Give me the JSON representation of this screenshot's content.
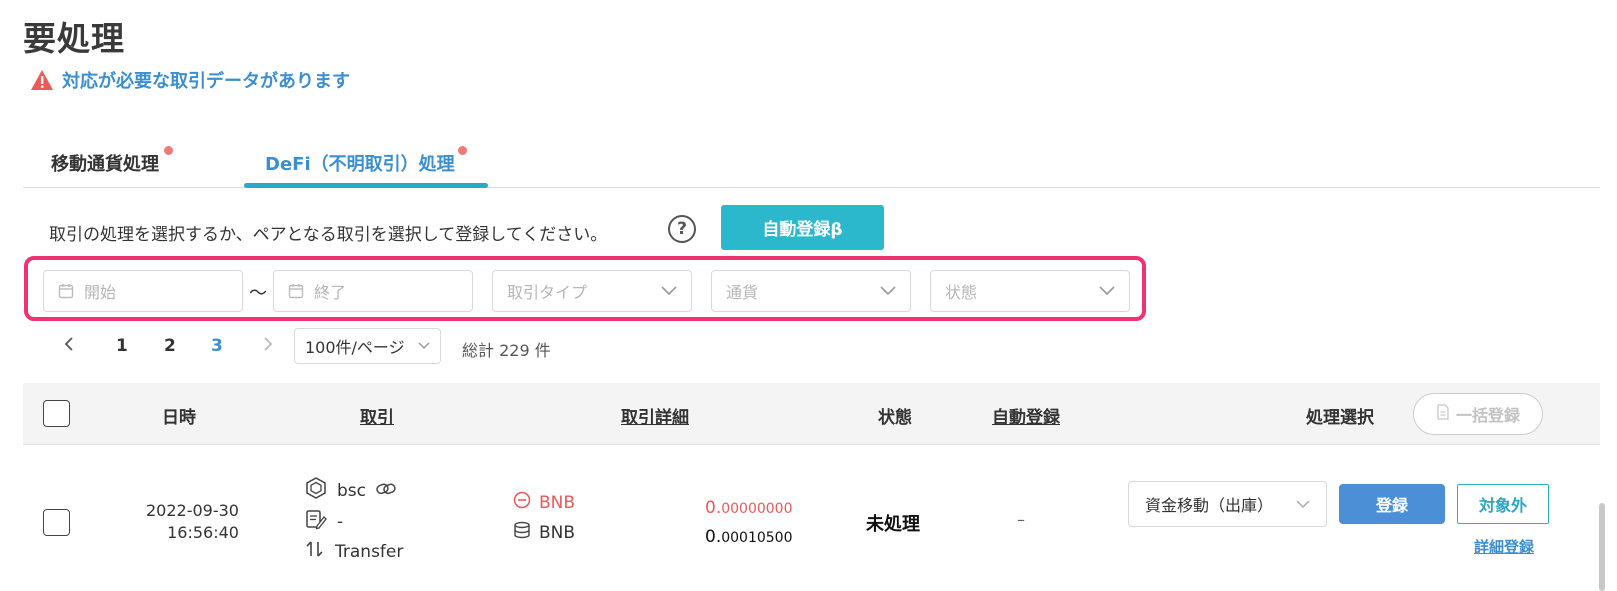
{
  "page": {
    "title": "要処理",
    "alert_text": "対応が必要な取引データがあります"
  },
  "tabs": [
    {
      "label": "移動通貨処理",
      "active": false,
      "has_dot": true
    },
    {
      "label": "DeFi（不明取引）処理",
      "active": true,
      "has_dot": true
    }
  ],
  "toolbar": {
    "instruction": "取引の処理を選択するか、ペアとなる取引を選択して登録してください。",
    "help_label": "?",
    "auto_register_label": "自動登録β"
  },
  "filters": {
    "start_placeholder": "開始",
    "range_separator": "〜",
    "end_placeholder": "終了",
    "type_placeholder": "取引タイプ",
    "currency_placeholder": "通貨",
    "status_placeholder": "状態"
  },
  "pagination": {
    "pages": [
      "1",
      "2",
      "3"
    ],
    "current_page": "3",
    "per_page": "100件/ページ",
    "total": "総計 229 件"
  },
  "table": {
    "headers": {
      "datetime": "日時",
      "transaction": "取引",
      "detail": "取引詳細",
      "status": "状態",
      "auto_register": "自動登録",
      "action_select": "処理選択",
      "bulk_register": "一括登録"
    },
    "rows": [
      {
        "date": "2022-09-30",
        "time": "16:56:40",
        "chain": "bsc",
        "memo": "-",
        "tx_type": "Transfer",
        "out_currency": "BNB",
        "out_amount_int": "0.",
        "out_amount_dec": "00000000",
        "fee_currency": "BNB",
        "fee_amount_int": "0.",
        "fee_amount_dec": "00010500",
        "status": "未処理",
        "auto_register": "–",
        "action": "資金移動（出庫）",
        "register_label": "登録",
        "exclude_label": "対象外",
        "detail_label": "詳細登録"
      }
    ]
  },
  "colors": {
    "accent_blue": "#3b8fd0",
    "teal": "#2bb8cc",
    "filter_highlight": "#ee3370",
    "negative_red": "#e85a5a",
    "dot_red": "#f07a7a"
  }
}
